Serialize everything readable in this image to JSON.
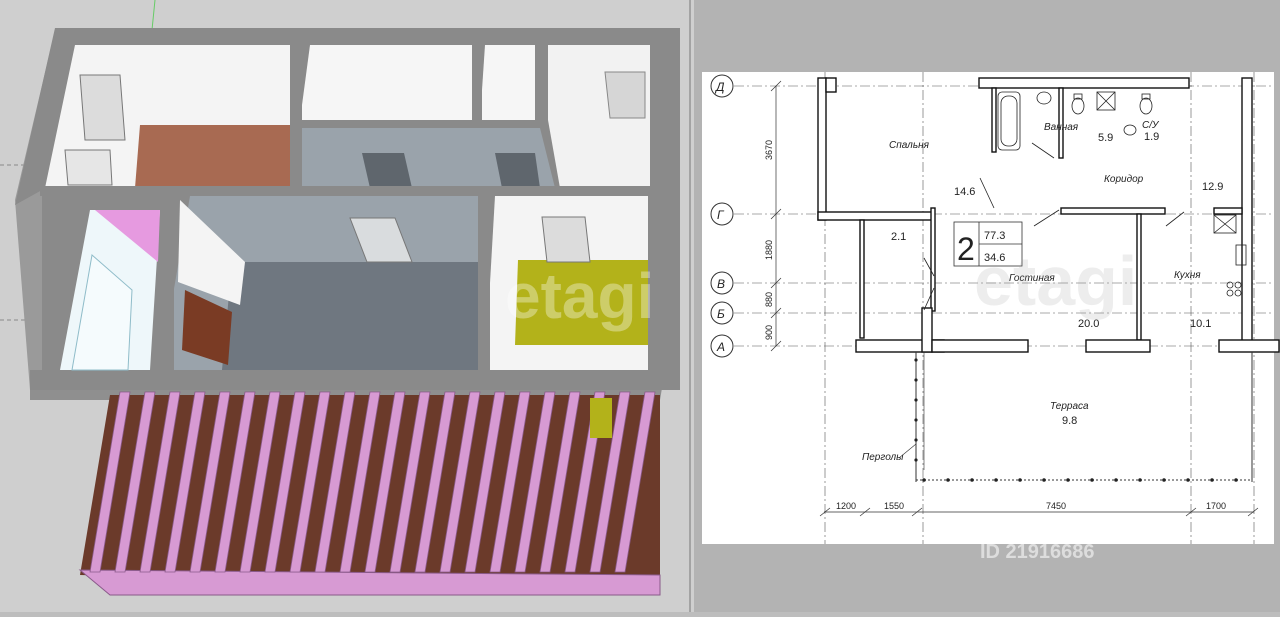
{
  "left_panel": {
    "view": "3d-model",
    "watermark": "etagi"
  },
  "plan": {
    "rooms": {
      "bedroom": {
        "label": "Спальня",
        "area": "14.6"
      },
      "bathroom": {
        "label": "Ванная",
        "area": "5.9"
      },
      "wc": {
        "label": "С/У",
        "area": "1.9"
      },
      "corridor": {
        "label": "Коридор",
        "area": "12.9"
      },
      "closet": {
        "area": "2.1"
      },
      "living": {
        "label": "Гостиная",
        "area": "20.0"
      },
      "kitchen": {
        "label": "Кухня",
        "area": "10.1"
      },
      "terrace": {
        "label": "Терраса",
        "area": "9.8"
      }
    },
    "apartment": {
      "rooms_count": "2",
      "total_area": "77.3",
      "living_area": "34.6"
    },
    "pergola_label": "Перголы",
    "axes": [
      "Д",
      "Г",
      "В",
      "Б",
      "А"
    ],
    "vertical_dims": [
      "3670",
      "1880",
      "880",
      "900"
    ],
    "horizontal_dims": [
      "1200",
      "1550",
      "7450",
      "1700"
    ],
    "watermark_id": "ID 21916686"
  },
  "colors": {
    "wall": "#8a8a8a",
    "floor_brown": "#a86a52",
    "floor_grey": "#6f7780",
    "floor_yellow": "#b3b21a",
    "pergola": "#d79ad3",
    "deck": "#6b3a2a"
  }
}
